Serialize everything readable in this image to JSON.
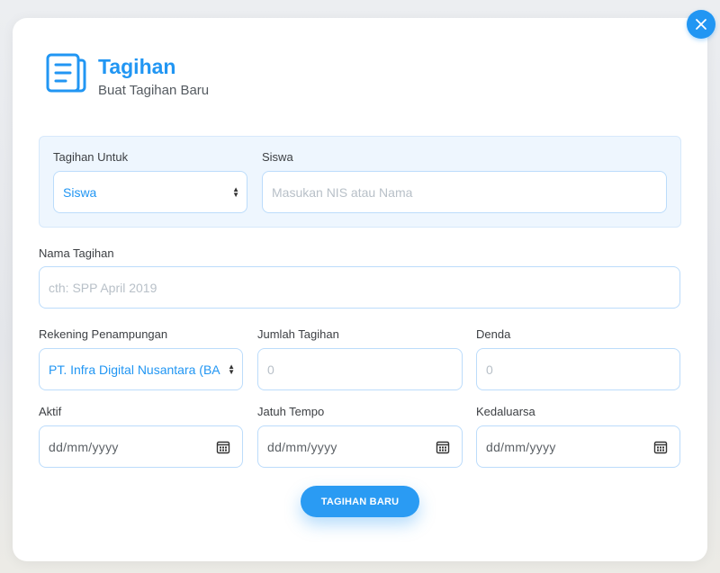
{
  "modal": {
    "title": "Tagihan",
    "subtitle": "Buat Tagihan Baru",
    "close_icon": "close-icon",
    "header_icon": "document-list-icon"
  },
  "recipient": {
    "target_label": "Tagihan Untuk",
    "target_value": "Siswa",
    "student_label": "Siswa",
    "student_placeholder": "Masukan NIS atau Nama"
  },
  "bill_name": {
    "label": "Nama Tagihan",
    "placeholder": "cth: SPP April 2019"
  },
  "account": {
    "label": "Rekening Penampungan",
    "value": "PT. Infra Digital Nusantara (BA"
  },
  "amount": {
    "label": "Jumlah Tagihan",
    "placeholder": "0"
  },
  "penalty": {
    "label": "Denda",
    "placeholder": "0"
  },
  "dates": {
    "active_label": "Aktif",
    "active_value": "dd/mm/yyyy",
    "due_label": "Jatuh Tempo",
    "due_value": "dd/mm/yyyy",
    "expiry_label": "Kedaluarsa",
    "expiry_value": "dd/mm/yyyy",
    "icon": "calendar-icon"
  },
  "submit_label": "TAGIHAN BARU",
  "colors": {
    "accent": "#2196f3",
    "panel_bg": "#eef6fe",
    "border": "#bcdcfb",
    "placeholder": "#b8c0c8"
  }
}
